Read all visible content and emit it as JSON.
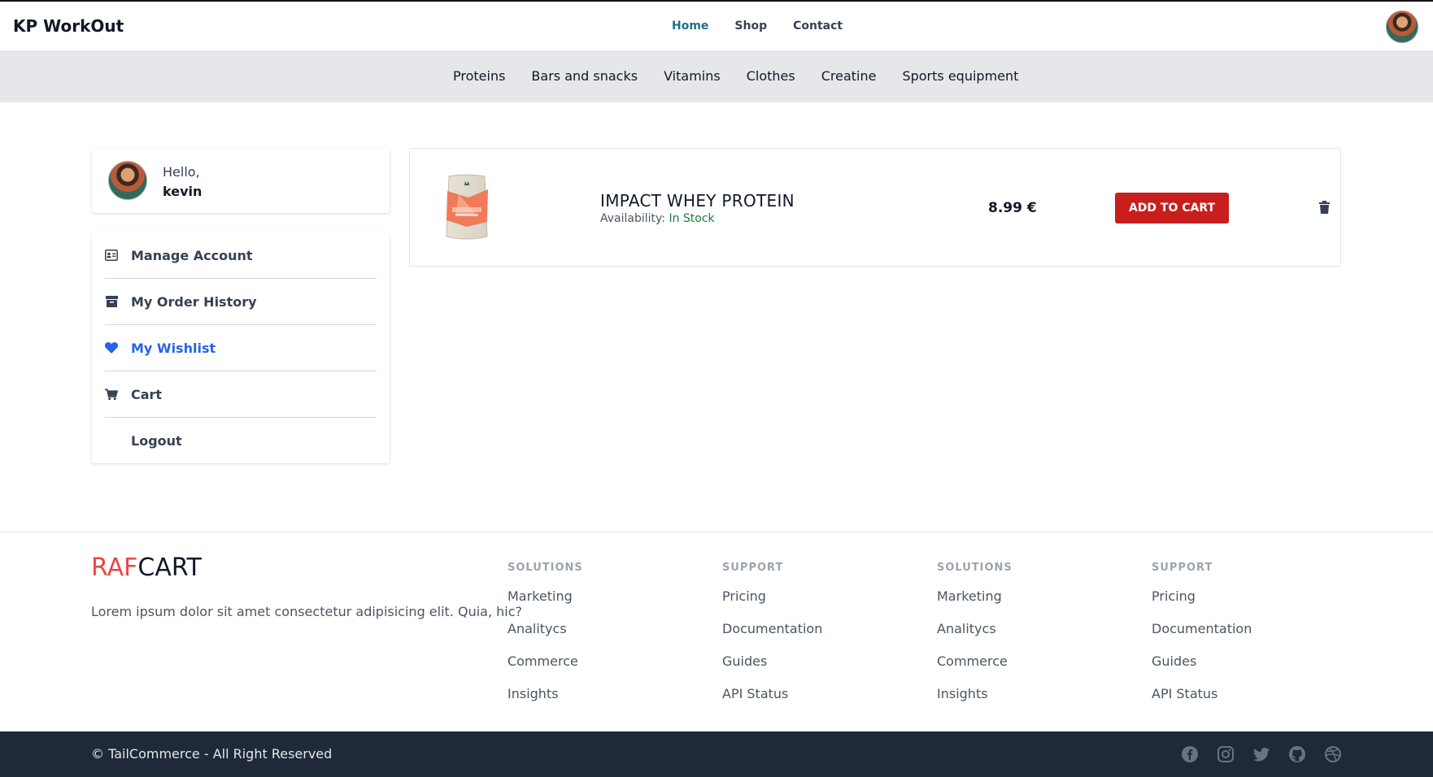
{
  "header": {
    "brand": "KP WorkOut",
    "nav": [
      {
        "label": "Home"
      },
      {
        "label": "Shop"
      },
      {
        "label": "Contact"
      }
    ],
    "active_nav": "Home",
    "accent_color": "#1f6f8b"
  },
  "categories": [
    "Proteins",
    "Bars and snacks",
    "Vitamins",
    "Clothes",
    "Creatine",
    "Sports equipment"
  ],
  "profile": {
    "greeting": "Hello,",
    "name": "kevin"
  },
  "sidebar": {
    "items": [
      {
        "label": "Manage Account",
        "icon": "id-card-icon"
      },
      {
        "label": "My Order History",
        "icon": "archive-icon"
      },
      {
        "label": "My Wishlist",
        "icon": "heart-icon",
        "active": true
      },
      {
        "label": "Cart",
        "icon": "cart-icon"
      },
      {
        "label": "Logout",
        "icon": ""
      }
    ],
    "active_color": "#2563eb"
  },
  "wishlist": {
    "items": [
      {
        "name": "IMPACT WHEY PROTEIN",
        "availability_label": "Availability:",
        "availability_value": "In Stock",
        "price": "8.99 €",
        "button_label": "ADD TO CART"
      }
    ],
    "button_color": "#c81e1e"
  },
  "footer": {
    "logo_part1": "RAF",
    "logo_part2": "CART",
    "description": "Lorem ipsum dolor sit amet consectetur adipisicing elit. Quia, hic?",
    "columns": [
      {
        "title": "SOLUTIONS",
        "links": [
          "Marketing",
          "Analitycs",
          "Commerce",
          "Insights"
        ]
      },
      {
        "title": "SUPPORT",
        "links": [
          "Pricing",
          "Documentation",
          "Guides",
          "API Status"
        ]
      },
      {
        "title": "SOLUTIONS",
        "links": [
          "Marketing",
          "Analitycs",
          "Commerce",
          "Insights"
        ]
      },
      {
        "title": "SUPPORT",
        "links": [
          "Pricing",
          "Documentation",
          "Guides",
          "API Status"
        ]
      }
    ],
    "copyright": "© TailCommerce - All Right Reserved",
    "social": [
      "facebook-icon",
      "instagram-icon",
      "twitter-icon",
      "github-icon",
      "dribbble-icon"
    ]
  }
}
